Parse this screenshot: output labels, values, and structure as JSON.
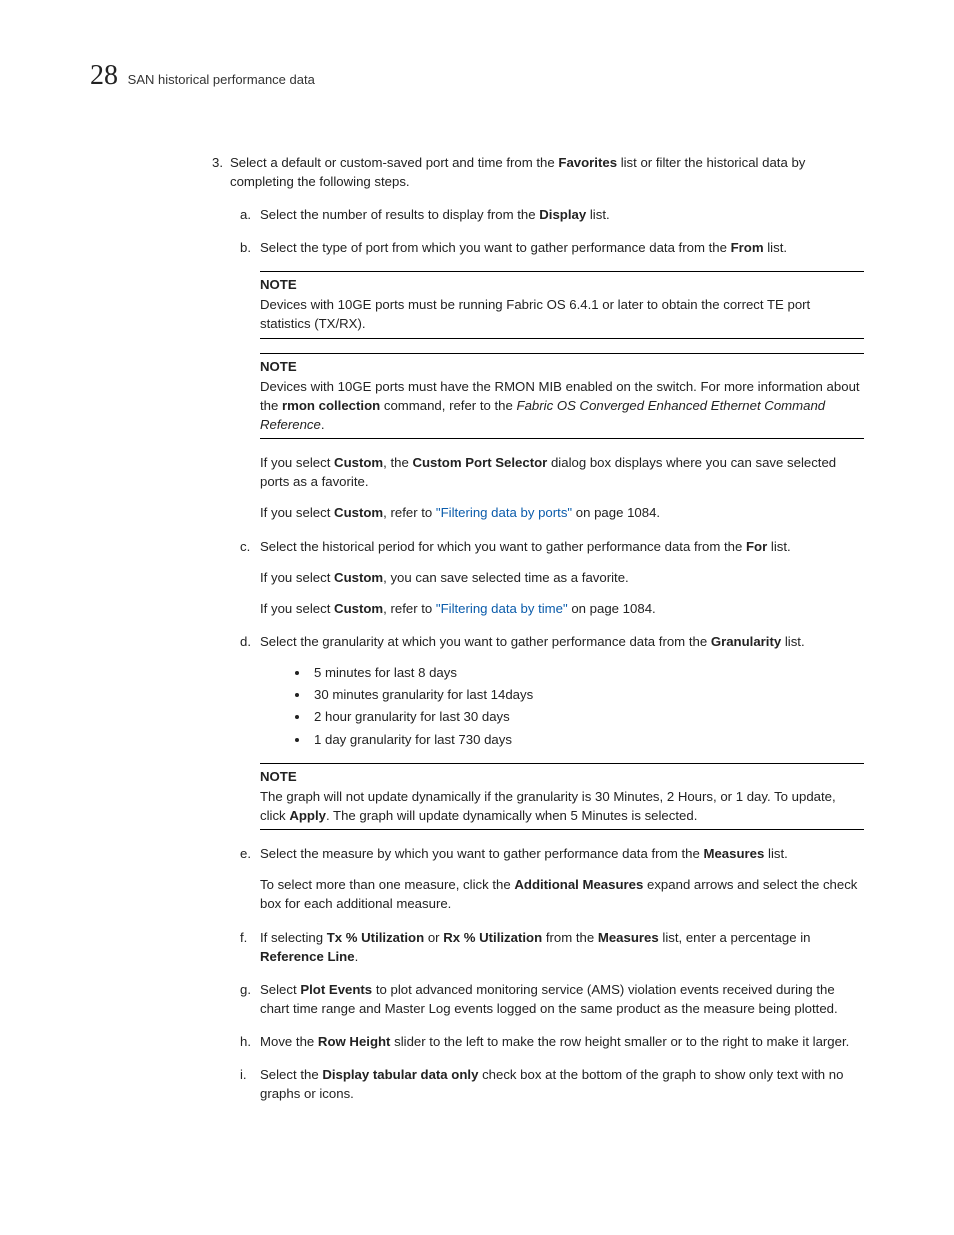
{
  "header": {
    "chapter_number": "28",
    "section_title": "SAN historical performance data"
  },
  "step3": {
    "label": "3.",
    "text_a": "Select a default or custom-saved port and time from the ",
    "favorites": "Favorites",
    "text_b": " list or filter the historical data by completing the following steps."
  },
  "a": {
    "label": "a.",
    "t1": "Select the number of results to display from the ",
    "display": "Display",
    "t2": " list."
  },
  "b": {
    "label": "b.",
    "t1": "Select the type of port from which you want to gather performance data from the ",
    "from": "From",
    "t2": " list."
  },
  "note1": {
    "title": "NOTE",
    "body": "Devices with 10GE ports must be running Fabric OS 6.4.1 or later to obtain the correct TE port statistics (TX/RX)."
  },
  "note2": {
    "title": "NOTE",
    "b1": "Devices with 10GE ports must have the RMON MIB enabled on the switch. For more information about the ",
    "rmon": "rmon collection",
    "b2": " command, refer to the ",
    "ref": "Fabric OS Converged Enhanced Ethernet Command Reference",
    "b3": "."
  },
  "custom1": {
    "t1": "If you select ",
    "custom": "Custom",
    "t2": ", the ",
    "cps": "Custom Port Selector",
    "t3": " dialog box displays where you can save selected ports as a favorite."
  },
  "custom2": {
    "t1": "If you select ",
    "custom": "Custom",
    "t2": ", refer to ",
    "link": "\"Filtering data by ports\"",
    "t3": " on page 1084."
  },
  "c": {
    "label": "c.",
    "t1": "Select the historical period for which you want to gather performance data from the ",
    "for": "For",
    "t2": " list."
  },
  "c_sub1": {
    "t1": "If you select ",
    "custom": "Custom",
    "t2": ", you can save selected time as a favorite."
  },
  "c_sub2": {
    "t1": "If you select ",
    "custom": "Custom",
    "t2": ", refer to ",
    "link": "\"Filtering data by time\"",
    "t3": " on page 1084."
  },
  "d": {
    "label": "d.",
    "t1": "Select the granularity at which you want to gather performance data from the ",
    "gran": "Granularity",
    "t2": " list.",
    "bullets": [
      "5 minutes for last 8 days",
      "30 minutes granularity for last 14days",
      "2 hour granularity for last 30 days",
      "1 day granularity for last 730 days"
    ]
  },
  "note3": {
    "title": "NOTE",
    "t1": "The graph will not update dynamically if the granularity is 30 Minutes, 2 Hours, or 1 day. To update, click ",
    "apply": "Apply",
    "t2": ". The graph will update dynamically when 5 Minutes is selected."
  },
  "e": {
    "label": "e.",
    "t1": "Select the measure by which you want to gather performance data from the ",
    "meas": "Measures",
    "t2": " list."
  },
  "e_sub": {
    "t1": "To select more than one measure, click the ",
    "am": "Additional Measures",
    "t2": " expand arrows and select the check box for each additional measure."
  },
  "f": {
    "label": "f.",
    "t1": "If selecting ",
    "tx": "Tx % Utilization",
    "t2": " or ",
    "rx": "Rx % Utilization",
    "t3": " from the ",
    "meas": "Measures",
    "t4": " list, enter a percentage in ",
    "rl": "Reference Line",
    "t5": "."
  },
  "g": {
    "label": "g.",
    "t1": "Select ",
    "pe": "Plot Events",
    "t2": " to plot advanced monitoring service (AMS) violation events received during the chart time range and Master Log events logged on the same product as the measure being plotted."
  },
  "h": {
    "label": "h.",
    "t1": "Move the ",
    "rh": "Row Height",
    "t2": " slider to the left to make the row height smaller or to the right to make it larger."
  },
  "i": {
    "label": "i.",
    "t1": "Select the ",
    "dtdo": "Display tabular data only",
    "t2": " check box at the bottom of the graph to show only text with no graphs or icons."
  }
}
